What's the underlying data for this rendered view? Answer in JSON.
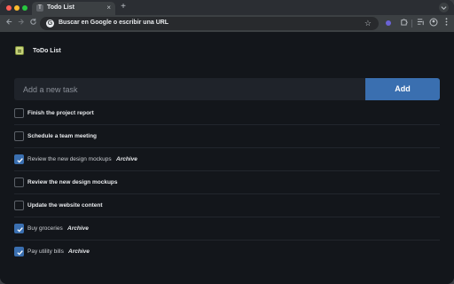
{
  "browser": {
    "tab_title": "Todo List",
    "tab_favicon": "T",
    "tab_close": "×",
    "new_tab": "+",
    "omnibox_text": "Buscar en Google o escribir una URL",
    "google_glyph": "G",
    "icons": [
      "back-icon",
      "forward-icon",
      "reload-icon",
      "star-icon",
      "extension-icon",
      "puzzle-icon",
      "media-icon",
      "profile-icon",
      "menu-icon"
    ]
  },
  "app": {
    "title": "ToDo List",
    "input_placeholder": "Add a new task",
    "add_label": "Add",
    "accent_color": "#3a6fb0"
  },
  "tasks": [
    {
      "text": "Finish the project report",
      "checked": false,
      "archive": ""
    },
    {
      "text": "Schedule a team meeting",
      "checked": false,
      "archive": ""
    },
    {
      "text": "Review the new design mockups",
      "checked": true,
      "archive": "Archive"
    },
    {
      "text": "Review the new design mockups",
      "checked": false,
      "archive": ""
    },
    {
      "text": "Update the website content",
      "checked": false,
      "archive": ""
    },
    {
      "text": "Buy groceries",
      "checked": true,
      "archive": "Archive"
    },
    {
      "text": "Pay utility bills",
      "checked": true,
      "archive": "Archive"
    }
  ]
}
